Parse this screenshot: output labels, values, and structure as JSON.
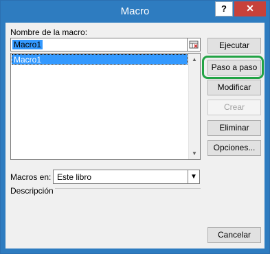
{
  "window": {
    "title": "Macro",
    "help_label": "?",
    "close_label": "✕"
  },
  "name": {
    "label": "Nombre de la macro:",
    "value": "Macro1",
    "ref_icon": "collapse-dialog-icon"
  },
  "macro_list": {
    "items": [
      "Macro1"
    ],
    "selected": 0
  },
  "buttons": {
    "run": "Ejecutar",
    "step": "Paso a paso",
    "edit": "Modificar",
    "create": "Crear",
    "delete": "Eliminar",
    "options": "Opciones...",
    "cancel": "Cancelar"
  },
  "macros_in": {
    "label": "Macros en:",
    "value": "Este libro"
  },
  "description": {
    "label": "Descripción"
  },
  "colors": {
    "titlebar": "#2e7cc0",
    "highlight": "#22a345",
    "selection": "#3399ff"
  }
}
